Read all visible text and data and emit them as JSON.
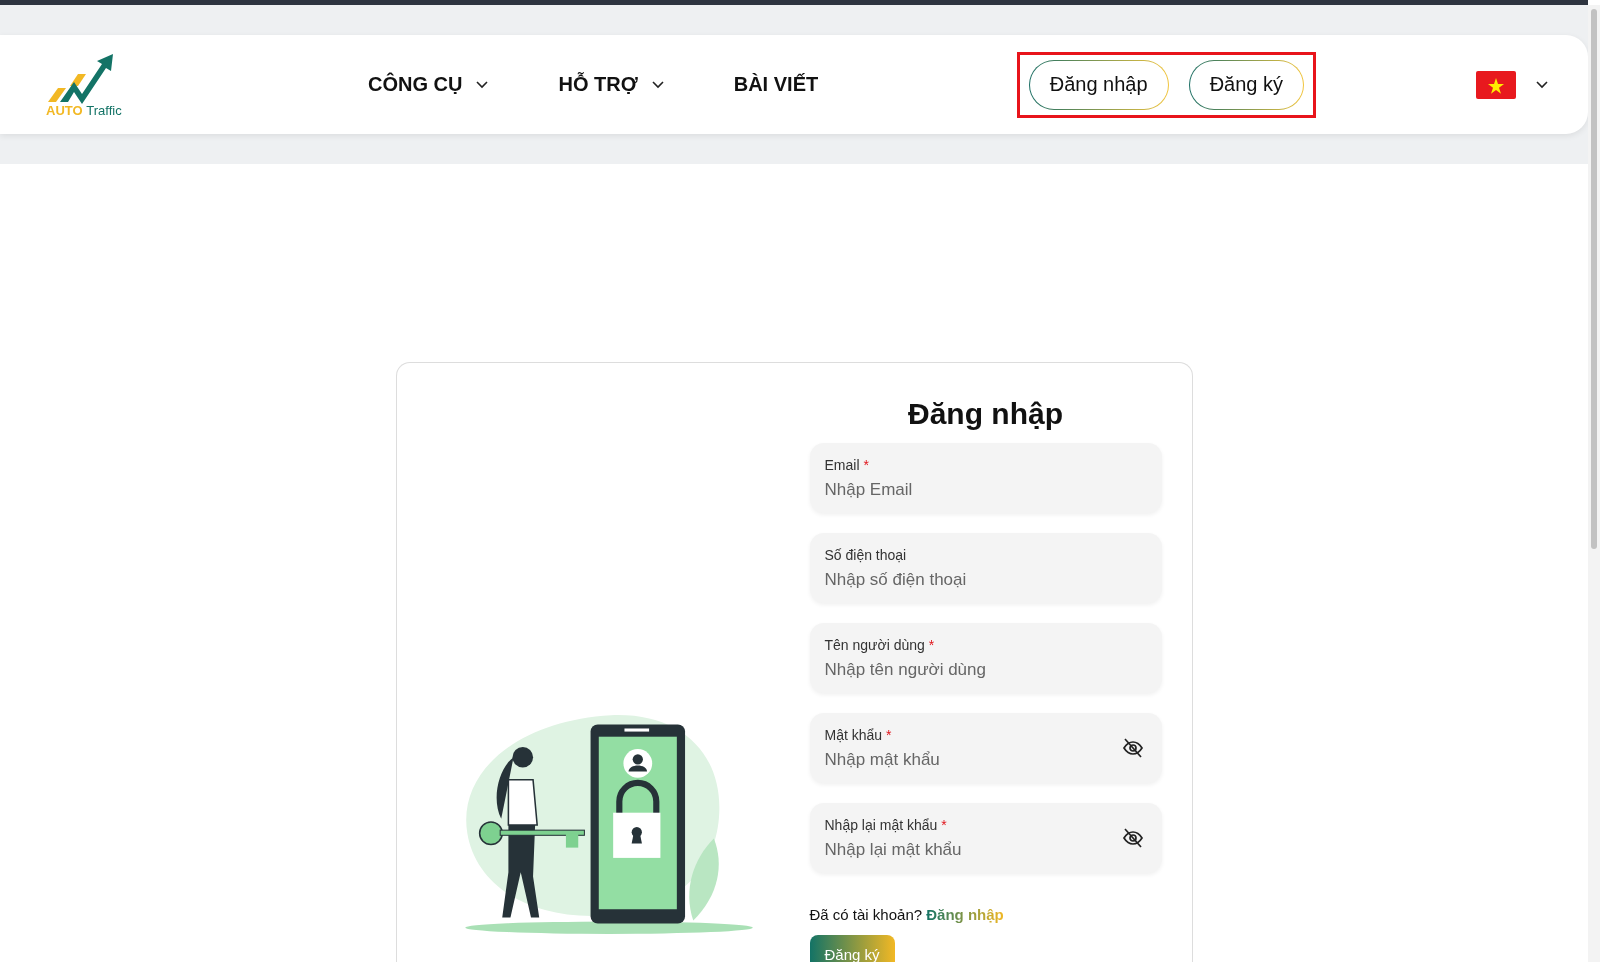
{
  "header": {
    "logo": {
      "word_1": "AUTO",
      "word_2": "Traffic"
    },
    "nav": [
      {
        "label": "CÔNG CỤ",
        "has_dropdown": true
      },
      {
        "label": "HỖ TRỢ",
        "has_dropdown": true
      },
      {
        "label": "BÀI VIẾT",
        "has_dropdown": false
      }
    ],
    "auth_buttons": [
      "Đăng nhập",
      "Đăng ký"
    ],
    "language": {
      "has_dropdown": true
    }
  },
  "form": {
    "title": "Đăng nhập",
    "required_mark": "*",
    "fields": [
      {
        "label": "Email",
        "required": true,
        "placeholder": "Nhập Email",
        "kind": "text"
      },
      {
        "label": "Số điện thoại",
        "required": false,
        "placeholder": "Nhập số điện thoại",
        "kind": "text"
      },
      {
        "label": "Tên người dùng",
        "required": true,
        "placeholder": "Nhập tên người dùng",
        "kind": "text"
      },
      {
        "label": "Mật khẩu",
        "required": true,
        "placeholder": "Nhập mật khẩu",
        "kind": "password"
      },
      {
        "label": "Nhập lại mật khẩu",
        "required": true,
        "placeholder": "Nhập lại mật khẩu",
        "kind": "password"
      }
    ],
    "login_prompt": {
      "text": "Đã có tài khoản?",
      "link": "Đăng nhập"
    },
    "submit": "Đăng ký"
  }
}
